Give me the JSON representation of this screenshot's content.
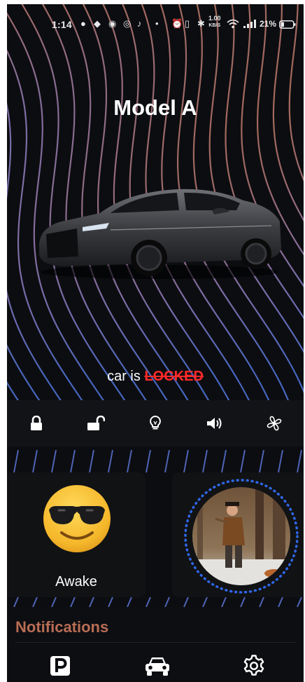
{
  "status_bar": {
    "time": "1:14",
    "network_speed": "1.00",
    "network_unit": "KB/S",
    "battery_percent": "21%"
  },
  "header": {
    "title": "Model A"
  },
  "lock_status": {
    "prefix": "car is ",
    "state": "LOCKED",
    "state_color": "#ff2a2a"
  },
  "controls": [
    {
      "name": "lock-button",
      "icon": "lock-icon"
    },
    {
      "name": "unlock-button",
      "icon": "unlock-icon"
    },
    {
      "name": "lights-button",
      "icon": "bulb-icon"
    },
    {
      "name": "horn-button",
      "icon": "speaker-icon"
    },
    {
      "name": "fan-button",
      "icon": "fan-icon"
    }
  ],
  "driver_status": {
    "label": "Awake",
    "emoji": "sunglasses-emoji"
  },
  "notifications": {
    "title": "Notifications",
    "title_color": "#b86d55"
  },
  "nav": [
    {
      "name": "nav-parking",
      "icon": "parking-icon"
    },
    {
      "name": "nav-car",
      "icon": "car-icon"
    },
    {
      "name": "nav-settings",
      "icon": "gear-icon"
    }
  ],
  "colors": {
    "background": "#0c0d10",
    "accent_blue": "#2f66e8",
    "wave_warm": "#b9735d",
    "wave_cool": "#4d6fd0"
  }
}
